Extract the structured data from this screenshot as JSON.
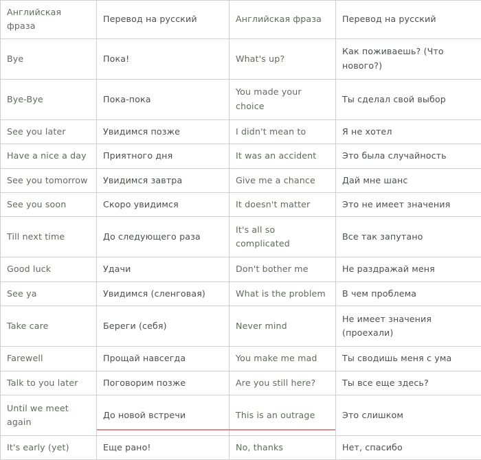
{
  "table": {
    "headers": {
      "english_1": "Английская фраза",
      "russian_1": "Перевод на русский",
      "english_2": "Английская фраза",
      "russian_2": "Перевод на русский"
    },
    "rows": [
      {
        "english_1": "Bye",
        "russian_1": "Пока!",
        "english_2": "What's up?",
        "russian_2": "Как поживаешь? (Что нового?)",
        "size": "tall"
      },
      {
        "english_1": "Bye-Bye",
        "russian_1": "Пока-пока",
        "english_2": "You made your choice",
        "russian_2": "Ты сделал свой выбор",
        "size": "tall"
      },
      {
        "english_1": "See you later",
        "russian_1": "Увидимся позже",
        "english_2": "I didn't mean to",
        "russian_2": "Я не хотел",
        "size": "short"
      },
      {
        "english_1": "Have a nice a day",
        "russian_1": "Приятного дня",
        "english_2": "It was an accident",
        "russian_2": "Это была случайность",
        "size": "short"
      },
      {
        "english_1": "See you tomorrow",
        "russian_1": "Увидимся завтра",
        "english_2": "Give me a chance",
        "russian_2": "Дай мне шанс",
        "size": "short"
      },
      {
        "english_1": "See you soon",
        "russian_1": "Скоро увидимся",
        "english_2": "It doesn't matter",
        "russian_2": "Это не имеет значения",
        "size": "short"
      },
      {
        "english_1": "Till next time",
        "russian_1": "До следующего раза",
        "english_2": "It's all so complicated",
        "russian_2": "Все так запутано",
        "size": "tall"
      },
      {
        "english_1": "Good luck",
        "russian_1": "Удачи",
        "english_2": "Don't bother me",
        "russian_2": "Не раздражай меня",
        "size": "short"
      },
      {
        "english_1": "See ya",
        "russian_1": "Увидимся (сленговая)",
        "english_2": "What is the problem",
        "russian_2": "В чем проблема",
        "size": "short"
      },
      {
        "english_1": "Take care",
        "russian_1": "Береги (себя)",
        "english_2": "Never mind",
        "russian_2": "Не имеет значения (проехали)",
        "size": "tall"
      },
      {
        "english_1": "Farewell",
        "russian_1": "Прощай навсегда",
        "english_2": "You make me mad",
        "russian_2": "Ты сводишь меня с ума",
        "size": "short"
      },
      {
        "english_1": "Talk to you later",
        "russian_1": "Поговорим позже",
        "english_2": "Are you still here?",
        "russian_2": "Ты все еще здесь?",
        "size": "short"
      },
      {
        "english_1": "Until we meet again",
        "russian_1": "До новой встречи",
        "english_2": "This is an outrage",
        "russian_2": "Это слишком",
        "size": "tall"
      },
      {
        "english_1": "It's early (yet)",
        "russian_1": "Еще рано!",
        "english_2": "No, thanks",
        "russian_2": "Нет, спасибо",
        "size": "short"
      }
    ]
  },
  "colors": {
    "english_text": "#5f6b5c",
    "russian_text": "#4a4f4a",
    "grid_line": "#cfcfcf",
    "bottom_rule": "#d9737d",
    "background": "#ffffff"
  }
}
